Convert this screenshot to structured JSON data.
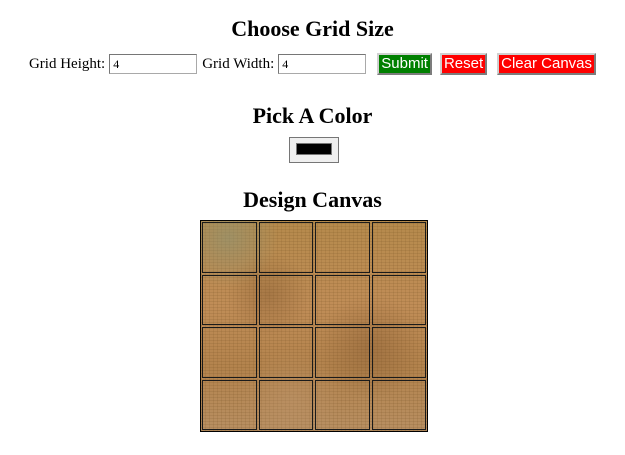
{
  "grid_size": {
    "heading": "Choose Grid Size",
    "height_label": "Grid Height:",
    "height_value": "4",
    "width_label": "Grid Width:",
    "width_value": "4",
    "submit_label": "Submit",
    "reset_label": "Reset",
    "clear_label": "Clear Canvas"
  },
  "color": {
    "heading": "Pick A Color",
    "selected_color": "#000000"
  },
  "canvas": {
    "heading": "Design Canvas",
    "rows": 4,
    "columns": 4
  },
  "colors": {
    "submit_button": "#008000",
    "reset_button": "#ff0000",
    "clear_button": "#ff0000"
  }
}
